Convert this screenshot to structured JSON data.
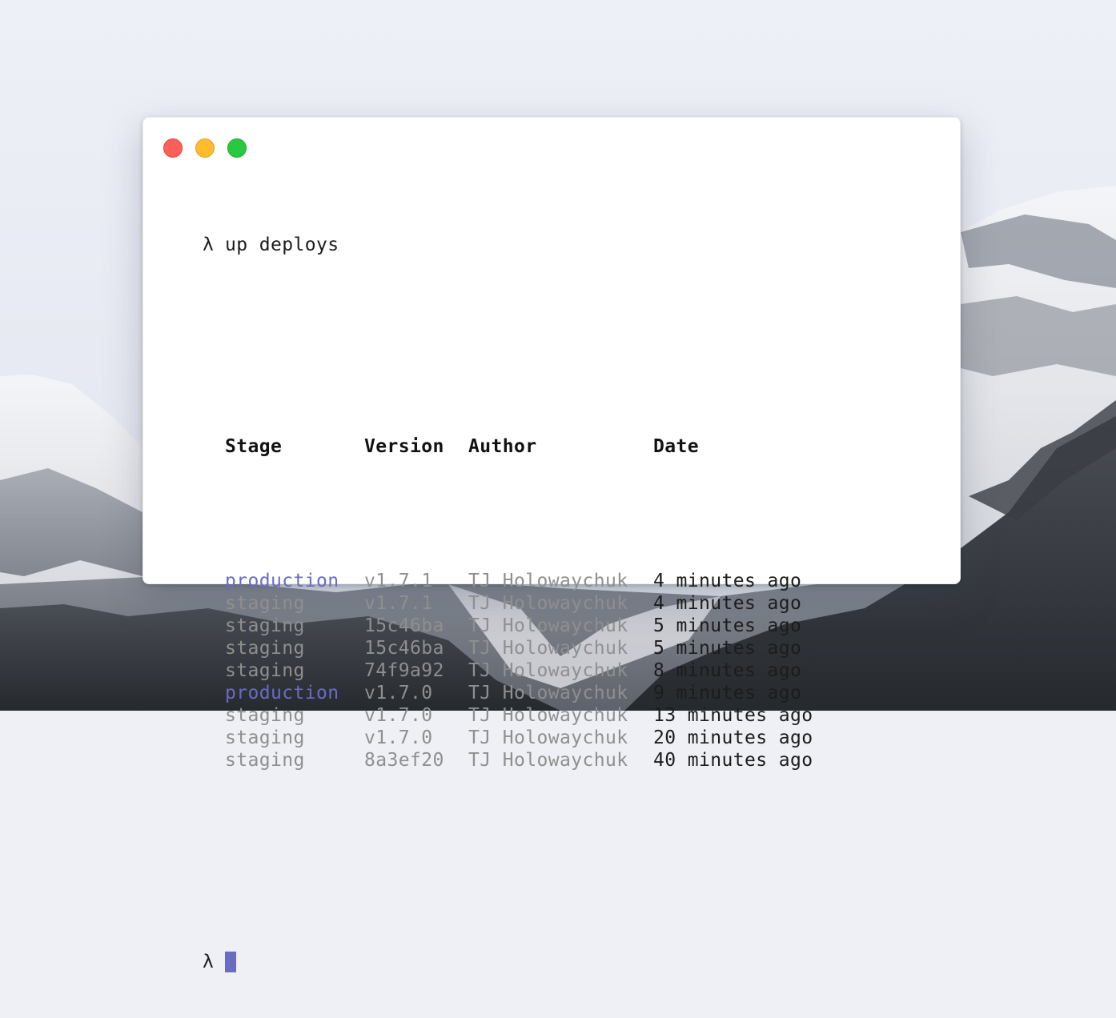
{
  "terminal": {
    "prompt_symbol": "λ",
    "command": "up deploys",
    "columns": [
      "Stage",
      "Version",
      "Author",
      "Date"
    ],
    "rows": [
      {
        "stage": "production",
        "version": "v1.7.1",
        "author": "TJ Holowaychuk",
        "date": "4 minutes ago",
        "stage_type": "production"
      },
      {
        "stage": "staging",
        "version": "v1.7.1",
        "author": "TJ Holowaychuk",
        "date": "4 minutes ago",
        "stage_type": "staging"
      },
      {
        "stage": "staging",
        "version": "15c46ba",
        "author": "TJ Holowaychuk",
        "date": "5 minutes ago",
        "stage_type": "staging"
      },
      {
        "stage": "staging",
        "version": "15c46ba",
        "author": "TJ Holowaychuk",
        "date": "5 minutes ago",
        "stage_type": "staging"
      },
      {
        "stage": "staging",
        "version": "74f9a92",
        "author": "TJ Holowaychuk",
        "date": "8 minutes ago",
        "stage_type": "staging"
      },
      {
        "stage": "production",
        "version": "v1.7.0",
        "author": "TJ Holowaychuk",
        "date": "9 minutes ago",
        "stage_type": "production"
      },
      {
        "stage": "staging",
        "version": "v1.7.0",
        "author": "TJ Holowaychuk",
        "date": "13 minutes ago",
        "stage_type": "staging"
      },
      {
        "stage": "staging",
        "version": "v1.7.0",
        "author": "TJ Holowaychuk",
        "date": "20 minutes ago",
        "stage_type": "staging"
      },
      {
        "stage": "staging",
        "version": "8a3ef20",
        "author": "TJ Holowaychuk",
        "date": "40 minutes ago",
        "stage_type": "staging"
      }
    ]
  },
  "window_controls": [
    "close",
    "minimize",
    "zoom"
  ],
  "colors": {
    "production": "#6a6bc2",
    "muted": "#8f8f8f",
    "cursor": "#6a6bc2",
    "close": "#fe5f57",
    "minimize": "#febc2e",
    "zoom": "#28c840"
  }
}
